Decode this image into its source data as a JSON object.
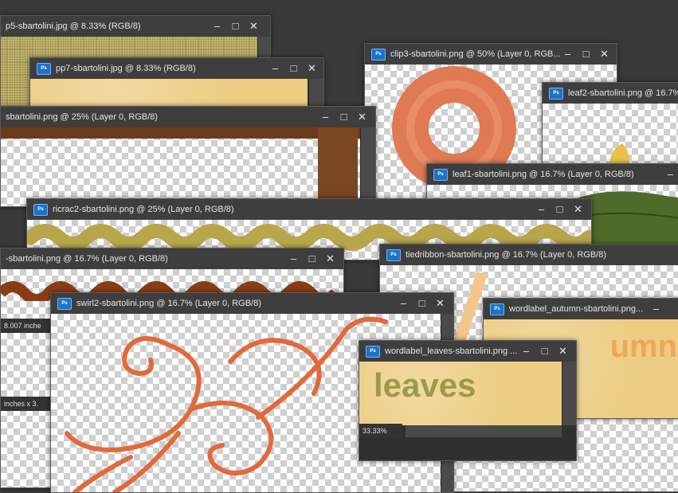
{
  "windows": {
    "pp5": {
      "title": "p5-sbartolini.jpg @ 8.33% (RGB/8)"
    },
    "pp7": {
      "title": "pp7-sbartolini.jpg @ 8.33% (RGB/8)"
    },
    "frame": {
      "title": "sbartolini.png @ 25% (Layer 0, RGB/8)"
    },
    "clip3": {
      "title": "clip3-sbartolini.png @ 50% (Layer 0, RGB..."
    },
    "leaf2": {
      "title": "leaf2-sbartolini.png @ 16.7%"
    },
    "leaf1": {
      "title": "leaf1-sbartolini.png @ 16.7% (Layer 0, RGB/8)"
    },
    "ricrac2": {
      "title": "ricrac2-sbartolini.png @ 25% (Layer 0, RGB/8)"
    },
    "brown": {
      "title": "-sbartolini.png @ 16.7% (Layer 0, RGB/8)",
      "status1": "8.007 inche",
      "status2": "inches x 3."
    },
    "tiedribbon": {
      "title": "tiedribbon-sbartolini.png @ 16.7% (Layer 0, RGB/8)"
    },
    "swirl2": {
      "title": "swirl2-sbartolini.png @ 16.7% (Layer 0, RGB/8)"
    },
    "autumn": {
      "title": "wordlabel_autumn-sbartolini.png...",
      "word": "umn"
    },
    "leaves": {
      "title": "wordlabel_leaves-sbartolini.png ...",
      "word": "leaves",
      "zoom": "33.33%"
    }
  },
  "controls": {
    "minimize": "‒",
    "maximize": "□",
    "close": "✕"
  },
  "icons": {
    "ps": "Ps"
  },
  "colors": {
    "accent": "#1e73c8",
    "titlebar": "#3e3e3e",
    "swirl": "#e06a3c"
  }
}
